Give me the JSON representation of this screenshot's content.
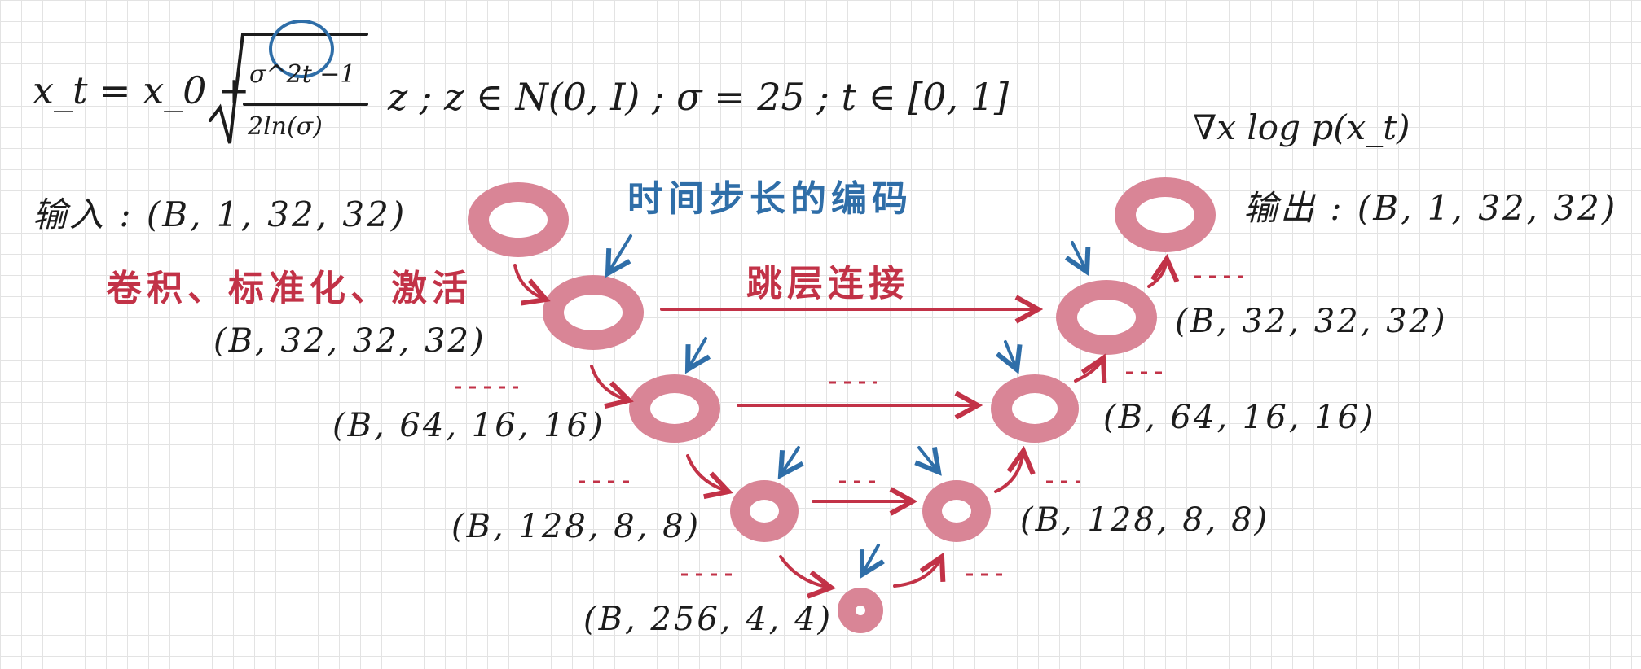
{
  "formula": {
    "lhs": "x_t = x_0 +",
    "numerator": "σ^2t −1",
    "denominator": "2ln(σ)",
    "rest": "z ; z ∈ N(0, I) ; σ = 25 ; t ∈ [0, 1]"
  },
  "score_label": "∇x log p(x_t)",
  "input_label": "输入 : (B, 1, 32, 32)",
  "output_label": "输出 : (B, 1, 32, 32)",
  "conv_label": "卷积、标准化、激活",
  "time_encoding_label": "时间步长的编码",
  "skip_label": "跳层连接",
  "dims": {
    "enc_32": "(B, 32, 32, 32)",
    "enc_64": "(B, 64, 16, 16)",
    "enc_128": "(B, 128, 8, 8)",
    "bottom": "(B, 256, 4, 4)",
    "dec_128": "(B, 128, 8, 8)",
    "dec_64": "(B, 64, 16, 16)",
    "dec_32": "(B, 32, 32, 32)"
  },
  "colors": {
    "node_fill": "#d98596",
    "arrow_red": "#c23247",
    "arrow_blue": "#2f6ea8",
    "ink": "#1c1c1c"
  }
}
